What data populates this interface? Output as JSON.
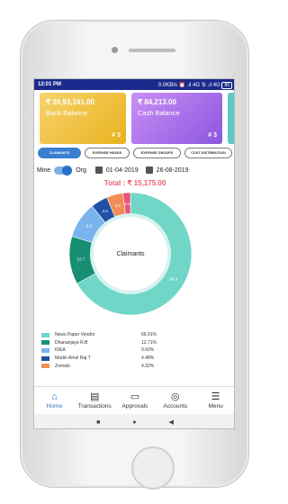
{
  "status_bar": {
    "time": "12:01 PM",
    "right": "0.0KB/s ⏰ .ıl 4G ⇅ .ıl 4G",
    "battery": "86"
  },
  "cards": [
    {
      "amount": "₹ 39,93,161.00",
      "label": "Bank Balance",
      "count": "# 3",
      "color": "#f2c94c"
    },
    {
      "amount": "₹ 84,213.00",
      "label": "Cash Balance",
      "count": "# 3",
      "color": "#a66cf0"
    }
  ],
  "tabs": [
    "CLAIMANTS",
    "EXPENSE HEADS",
    "EXPENSE GROUPS",
    "COST DISTRIBUTION"
  ],
  "filters": {
    "mine": "Mine",
    "org": "Org",
    "from_date": "01-04-2019",
    "to_date": "26-08-2019"
  },
  "total": "Total : ₹ 15,175.00",
  "chart_data": {
    "type": "pie",
    "center_label": "Claimants",
    "slices": [
      {
        "name": "News Paper Vendor",
        "value": 66.91,
        "label": "66.9",
        "pct": "66.91%",
        "color": "#6fd6c8"
      },
      {
        "name": "Dhananjaya R.B",
        "value": 12.71,
        "label": "12.7",
        "pct": "12.71%",
        "color": "#178f72"
      },
      {
        "name": "IDEA",
        "value": 9.6,
        "label": "9.6",
        "pct": "9.60%",
        "color": "#7ab4ee"
      },
      {
        "name": "Martin Amul Raj T",
        "value": 4.48,
        "label": "4.5",
        "pct": "4.48%",
        "color": "#1f52a6"
      },
      {
        "name": "Zomato",
        "value": 4.32,
        "label": "4.3",
        "pct": "4.32%",
        "color": "#f28c56"
      },
      {
        "name": "",
        "value": 2.0,
        "label": "2.0",
        "pct": "",
        "color": "#e8547a"
      }
    ]
  },
  "nav": [
    {
      "label": "Home",
      "icon": "home-icon"
    },
    {
      "label": "Transactions",
      "icon": "transactions-icon"
    },
    {
      "label": "Approvals",
      "icon": "approvals-icon"
    },
    {
      "label": "Accounts",
      "icon": "accounts-icon"
    },
    {
      "label": "Menu",
      "icon": "menu-icon"
    }
  ]
}
